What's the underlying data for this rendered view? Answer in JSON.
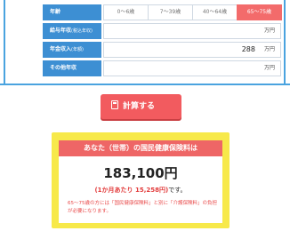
{
  "form": {
    "age_label": "年齢",
    "age_options": [
      "0〜6歳",
      "7〜39歳",
      "40〜64歳",
      "65〜75歳"
    ],
    "age_selected": "65〜75歳",
    "salary_label": "給与年収",
    "salary_sub": "(税込年収)",
    "salary_value": "",
    "salary_unit": "万円",
    "pension_label": "年金収入",
    "pension_sub": "(年額)",
    "pension_value": "288",
    "pension_unit": "万円",
    "other_label": "その他年収",
    "other_value": "",
    "other_unit": "万円"
  },
  "calc_button": {
    "label": "計算する"
  },
  "result": {
    "heading": "あなた（世帯）の国民健康保険料は",
    "amount": "183,100円",
    "monthly_prefix": "(1か月あたり 15,258円)",
    "monthly_suffix": "です。",
    "note": "65〜75歳の方には「国民健康保険料」と別に「介護保険料」の負担が必要になります。"
  },
  "colors": {
    "accent_blue": "#3d8fd3",
    "accent_red": "#f25b5f",
    "result_yellow": "#f7e94a"
  }
}
